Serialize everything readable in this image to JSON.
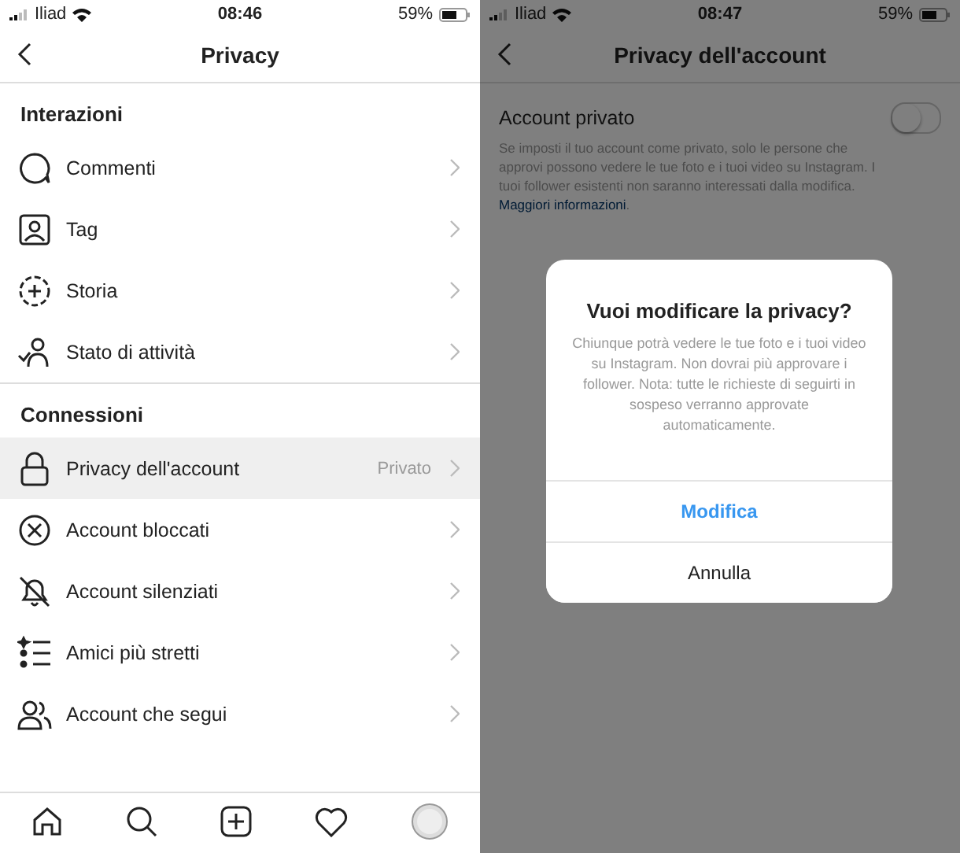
{
  "left": {
    "status_bar": {
      "carrier": "Iliad",
      "time": "08:46",
      "battery": "59%"
    },
    "title": "Privacy",
    "sections": [
      {
        "header": "Interazioni",
        "items": [
          {
            "label": "Commenti",
            "selected": false
          },
          {
            "label": "Tag",
            "selected": false
          },
          {
            "label": "Storia",
            "selected": false
          },
          {
            "label": "Stato di attività",
            "selected": false
          }
        ]
      },
      {
        "header": "Connessioni",
        "items": [
          {
            "label": "Privacy dell'account",
            "value": "Privato",
            "selected": true
          },
          {
            "label": "Account bloccati",
            "selected": false
          },
          {
            "label": "Account silenziati",
            "selected": false
          },
          {
            "label": "Amici più stretti",
            "selected": false
          },
          {
            "label": "Account che segui",
            "selected": false
          }
        ]
      }
    ]
  },
  "right": {
    "status_bar": {
      "carrier": "Iliad",
      "time": "08:47",
      "battery": "59%"
    },
    "title": "Privacy dell'account",
    "setting": {
      "label": "Account privato",
      "on": false,
      "description": "Se imposti il tuo account come privato, solo le persone che approvi possono vedere le tue foto e i tuoi video su Instagram. I tuoi follower esistenti non saranno interessati dalla modifica.",
      "link": "Maggiori informazioni",
      "link_end": "."
    },
    "dialog": {
      "title": "Vuoi modificare la privacy?",
      "message": "Chiunque potrà vedere le tue foto e i tuoi video su Instagram. Non dovrai più approvare i follower. Nota: tutte le richieste di seguirti in sospeso verranno approvate automaticamente.",
      "buttons": [
        {
          "label": "Modifica",
          "kind": "primary"
        },
        {
          "label": "Annulla",
          "kind": "cancel"
        }
      ]
    }
  }
}
